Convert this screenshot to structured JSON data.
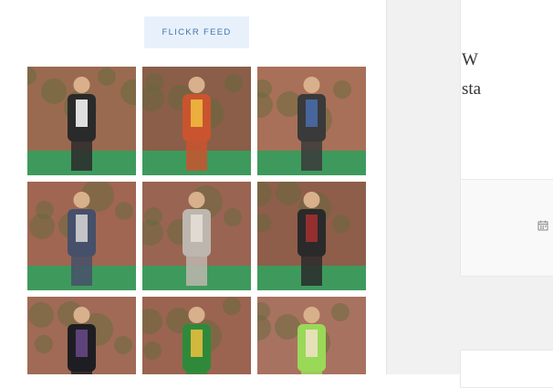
{
  "flickr_button": {
    "label": "FLICKR FEED"
  },
  "photos": [
    {
      "name": "beetlejuice-costume",
      "bg": "#9a6a50",
      "fig": "#2a2a2a",
      "accent": "#ffffff"
    },
    {
      "name": "group-costume-party",
      "bg": "#8a5e48",
      "fig": "#c9542f",
      "accent": "#f0c040"
    },
    {
      "name": "two-men-posing",
      "bg": "#a87058",
      "fig": "#3a3a3a",
      "accent": "#4a6fb0"
    },
    {
      "name": "man-bathrobe-costume",
      "bg": "#a06652",
      "fig": "#46506a",
      "accent": "#d8d8d8"
    },
    {
      "name": "rabbit-onesie-costume",
      "bg": "#9a6452",
      "fig": "#bdb6ae",
      "accent": "#e6e0d8"
    },
    {
      "name": "gladiator-costume",
      "bg": "#8e5e4a",
      "fig": "#2a2a2a",
      "accent": "#a83030"
    },
    {
      "name": "dark-dress-costume",
      "bg": "#a06a56",
      "fig": "#1e1e22",
      "accent": "#6a4a8a"
    },
    {
      "name": "dinosaur-costume",
      "bg": "#9a6450",
      "fig": "#2e8a3a",
      "accent": "#f0c040"
    },
    {
      "name": "green-shirt-man",
      "bg": "#a87260",
      "fig": "#9ad858",
      "accent": "#f2e2c8"
    }
  ],
  "post_excerpt": {
    "line1": "W",
    "line2": "sta"
  }
}
